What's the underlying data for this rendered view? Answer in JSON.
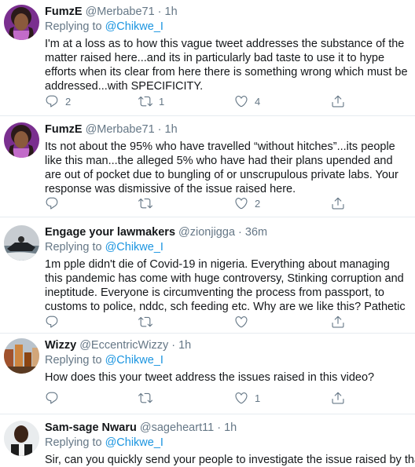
{
  "tweets": [
    {
      "name": "FumzE",
      "handle": "@Merbabe71",
      "separator": "·",
      "time": "1h",
      "replying_prefix": "Replying to",
      "replying_to": "@Chikwe_I",
      "text": "I'm at a loss as to how this vague tweet addresses the substance of the matter raised here...and its in particularly bad taste to use it to hype efforts when its clear from here there is something wrong which must be addressed...with SPECIFICITY.",
      "reply_count": "2",
      "retweet_count": "1",
      "like_count": "4"
    },
    {
      "name": "FumzE",
      "handle": "@Merbabe71",
      "separator": "·",
      "time": "1h",
      "text": "Its not about the 95% who have travelled “without hitches”...its people like this man...the alleged 5% who have had their plans upended and are out of pocket due to bungling of or unscrupulous private labs. Your response was dismissive of the issue raised here.",
      "reply_count": "",
      "retweet_count": "",
      "like_count": "2"
    },
    {
      "name": "Engage your lawmakers",
      "handle": "@zionjigga",
      "separator": "·",
      "time": "36m",
      "replying_prefix": "Replying to",
      "replying_to": "@Chikwe_I",
      "text": "1m pple didn't die of Covid-19 in nigeria. Everything about managing this pandemic has come with huge controversy, Stinking corruption and ineptitude. Everyone is circumventing the process from passport, to customs to police, nddc, sch feeding etc. Why are we like this? Pathetic",
      "reply_count": "",
      "retweet_count": "",
      "like_count": ""
    },
    {
      "name": "Wizzy",
      "handle": "@EccentricWizzy",
      "separator": "·",
      "time": "1h",
      "replying_prefix": "Replying to",
      "replying_to": "@Chikwe_I",
      "text": "How does this your tweet address the issues raised in this video?",
      "reply_count": "",
      "retweet_count": "",
      "like_count": "1"
    },
    {
      "name": "Sam-sage Nwaru",
      "handle": "@sageheart11",
      "separator": "·",
      "time": "1h",
      "replying_prefix": "Replying to",
      "replying_to": "@Chikwe_I",
      "text": "Sir, can you quickly send your people to investigate the issue raised by that"
    }
  ],
  "icons": {
    "reply": "reply-icon",
    "retweet": "retweet-icon",
    "like": "heart-icon",
    "share": "share-icon"
  },
  "colors": {
    "link": "#1b95e0",
    "secondary_text": "#657786",
    "divider": "#e6ecf0"
  }
}
